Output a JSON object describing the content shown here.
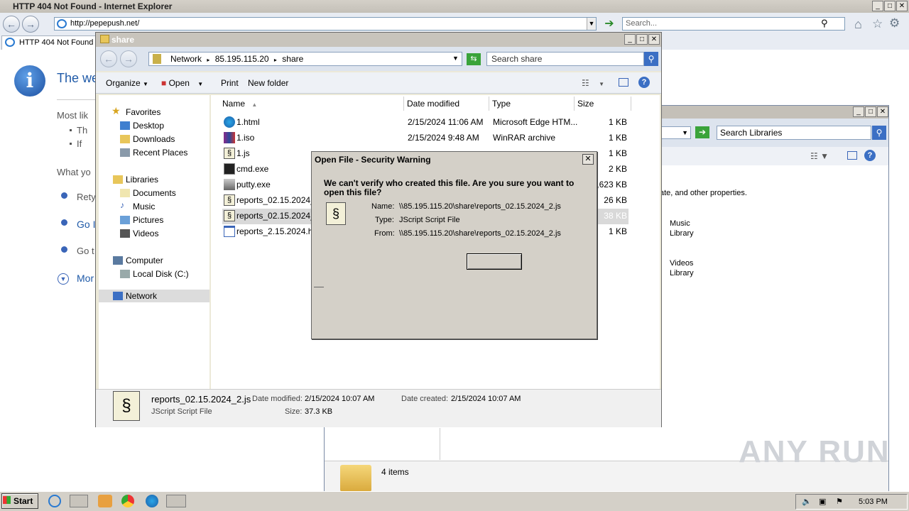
{
  "ie": {
    "title": "HTTP 404 Not Found - Internet Explorer",
    "url": "http://pepepush.net/",
    "search_placeholder": "Search...",
    "tab_label": "HTTP 404 Not Found",
    "heading": "The we",
    "text_most": "Most lik",
    "bullet1": "Th",
    "bullet2": "If",
    "text_what": "What yo",
    "link_retry": "Rety",
    "link_go1": "Go I",
    "link_go2": "Go t",
    "link_more": "Mor"
  },
  "libraries": {
    "search_placeholder": "Search Libraries",
    "props_text": "ate, and other properties.",
    "music": "Music",
    "music_sub": "Library",
    "videos": "Videos",
    "videos_sub": "Library",
    "items_count": "4 items"
  },
  "explorer": {
    "title": "share",
    "breadcrumb": [
      "Network",
      "85.195.115.20",
      "share"
    ],
    "search_placeholder": "Search share",
    "toolbar": {
      "organize": "Organize",
      "open": "Open",
      "print": "Print",
      "new_folder": "New folder"
    },
    "nav": {
      "favorites": "Favorites",
      "desktop": "Desktop",
      "downloads": "Downloads",
      "recent": "Recent Places",
      "libraries": "Libraries",
      "documents": "Documents",
      "music": "Music",
      "pictures": "Pictures",
      "videos": "Videos",
      "computer": "Computer",
      "local_disk": "Local Disk (C:)",
      "network": "Network"
    },
    "columns": {
      "name": "Name",
      "date": "Date modified",
      "type": "Type",
      "size": "Size"
    },
    "files": [
      {
        "name": "1.html",
        "date": "2/15/2024 11:06 AM",
        "type": "Microsoft Edge HTM...",
        "size": "1 KB",
        "icon": "edge-icon"
      },
      {
        "name": "1.iso",
        "date": "2/15/2024 9:48 AM",
        "type": "WinRAR archive",
        "size": "1 KB",
        "icon": "winrar-icon"
      },
      {
        "name": "1.js",
        "date": "",
        "type": "",
        "size": "1 KB",
        "icon": "script-icon"
      },
      {
        "name": "cmd.exe",
        "date": "",
        "type": "",
        "size": "2 KB",
        "icon": "cmd-icon"
      },
      {
        "name": "putty.exe",
        "date": "",
        "type": "",
        "size": ",623 KB",
        "icon": "putty-icon"
      },
      {
        "name": "reports_02.15.2024_",
        "date": "",
        "type": "",
        "size": "26 KB",
        "icon": "script-icon"
      },
      {
        "name": "reports_02.15.2024_",
        "date": "",
        "type": "",
        "size": "38 KB",
        "icon": "script-icon"
      },
      {
        "name": "reports_2.15.2024.ht",
        "date": "",
        "type": "",
        "size": "1 KB",
        "icon": "html-icon"
      }
    ],
    "status": {
      "filename": "reports_02.15.2024_2.js",
      "date_modified_label": "Date modified:",
      "date_modified": "2/15/2024 10:07 AM",
      "date_created_label": "Date created:",
      "date_created": "2/15/2024 10:07 AM",
      "type": "JScript Script File",
      "size_label": "Size:",
      "size": "37.3 KB"
    }
  },
  "dialog": {
    "title": "Open File - Security Warning",
    "question": "We can't verify who created this file. Are you sure you want to open this file?",
    "name_label": "Name:",
    "name": "\\\\85.195.115.20\\share\\reports_02.15.2024_2.js",
    "type_label": "Type:",
    "type": "JScript Script File",
    "from_label": "From:",
    "from": "\\\\85.195.115.20\\share\\reports_02.15.2024_2.js",
    "button_label": ""
  },
  "taskbar": {
    "start": "Start",
    "clock": "5:03 PM"
  },
  "watermark": "ANY RUN"
}
